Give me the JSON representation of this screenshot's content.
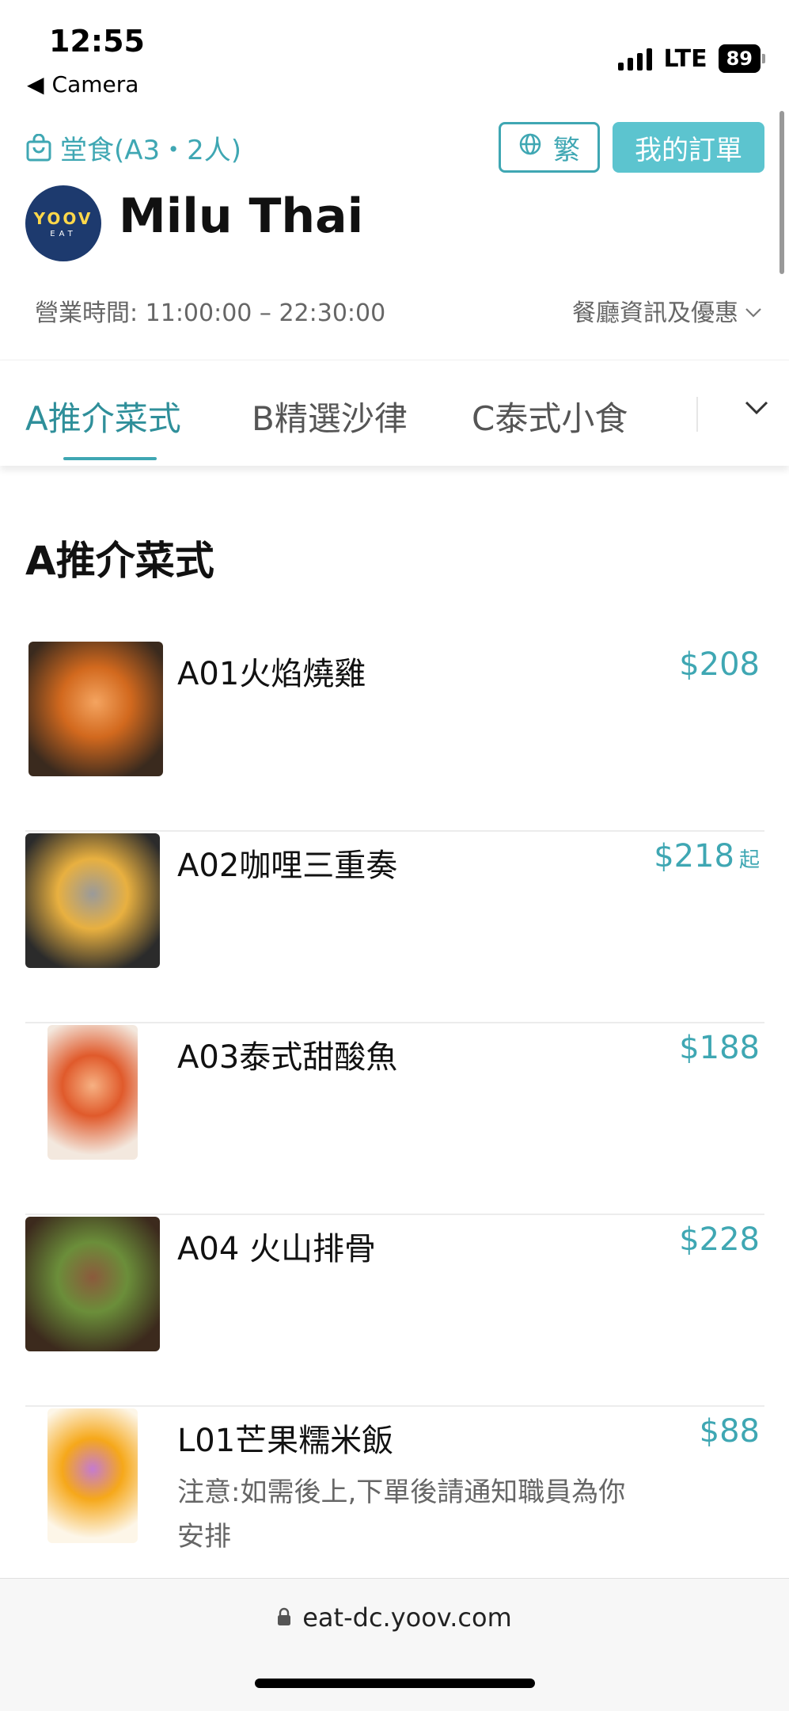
{
  "status_bar": {
    "time": "12:55",
    "back_label": "Camera",
    "network": "LTE",
    "battery": "89"
  },
  "header": {
    "dine_info": "堂食(A3・2人)",
    "language_label": "繁",
    "my_orders_label": "我的訂單",
    "logo_text_top": "YOOV",
    "logo_text_bottom": "EAT",
    "restaurant_name": "Milu Thai",
    "hours": "營業時間: 11:00:00 – 22:30:00",
    "info_link": "餐廳資訊及優惠"
  },
  "tabs": [
    {
      "label": "A推介菜式",
      "active": true
    },
    {
      "label": "B精選沙律",
      "active": false
    },
    {
      "label": "C泰式小食",
      "active": false
    }
  ],
  "section": {
    "title": "A推介菜式"
  },
  "menu_items": [
    {
      "name": "A01火焰燒雞",
      "price": "$208",
      "suffix": "",
      "note": "",
      "colors": [
        "#3a2a1e",
        "#d2691e",
        "#f4a460"
      ]
    },
    {
      "name": "A02咖哩三重奏",
      "price": "$218",
      "suffix": "起",
      "note": "",
      "colors": [
        "#2b2b2b",
        "#e8b040",
        "#9a9a9a"
      ]
    },
    {
      "name": "A03泰式甜酸魚",
      "price": "$188",
      "suffix": "",
      "note": "",
      "colors": [
        "#f3e8de",
        "#e05a2b",
        "#f6b183"
      ]
    },
    {
      "name": "A04 火山排骨",
      "price": "$228",
      "suffix": "",
      "note": "",
      "colors": [
        "#3c2a1d",
        "#6b8e3a",
        "#8b5a3c"
      ]
    },
    {
      "name": "L01芒果糯米飯",
      "price": "$88",
      "suffix": "",
      "note": "注意:如需後上,下單後請通知職員為你安排",
      "colors": [
        "#fdf6e8",
        "#f6a81a",
        "#c47bd1"
      ]
    }
  ],
  "browser": {
    "url": "eat-dc.yoov.com"
  },
  "colors": {
    "accent": "#3fa7b3",
    "orders_button": "#5cc4cf",
    "logo_bg": "#1d3a6e"
  }
}
